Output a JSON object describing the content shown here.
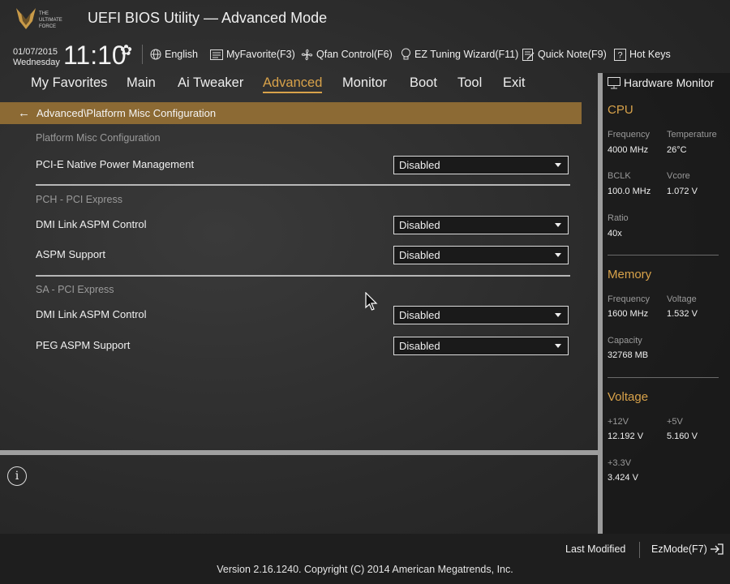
{
  "app": {
    "title": "UEFI BIOS Utility — Advanced Mode",
    "logo_text": "THE ULTIMATE FORCE"
  },
  "clock": {
    "date": "01/07/2015",
    "day": "Wednesday",
    "time": "11:10"
  },
  "toolbar": [
    {
      "label": "English",
      "icon": "globe-icon"
    },
    {
      "label": "MyFavorite(F3)",
      "icon": "favorite-list-icon"
    },
    {
      "label": "Qfan Control(F6)",
      "icon": "fan-icon"
    },
    {
      "label": "EZ Tuning Wizard(F11)",
      "icon": "lightbulb-icon"
    },
    {
      "label": "Quick Note(F9)",
      "icon": "note-icon"
    },
    {
      "label": "Hot Keys",
      "icon": "question-icon"
    }
  ],
  "nav": {
    "items": [
      "My Favorites",
      "Main",
      "Ai Tweaker",
      "Advanced",
      "Monitor",
      "Boot",
      "Tool",
      "Exit"
    ],
    "active": "Advanced"
  },
  "breadcrumb": "Advanced\\Platform Misc Configuration",
  "settings": {
    "platform_title": "Platform Misc Configuration",
    "pcie_native_label": "PCI-E Native Power Management",
    "pcie_native_value": "Disabled",
    "pch_title": "PCH - PCI Express",
    "pch_dmi_label": "DMI Link ASPM Control",
    "pch_dmi_value": "Disabled",
    "aspm_label": "ASPM Support",
    "aspm_value": "Disabled",
    "sa_title": "SA - PCI Express",
    "sa_dmi_label": "DMI Link ASPM Control",
    "sa_dmi_value": "Disabled",
    "peg_label": "PEG ASPM Support",
    "peg_value": "Disabled"
  },
  "hw_monitor": {
    "title": "Hardware Monitor",
    "cpu": {
      "title": "CPU",
      "frequency_label": "Frequency",
      "frequency": "4000 MHz",
      "temperature_label": "Temperature",
      "temperature": "26°C",
      "bclk_label": "BCLK",
      "bclk": "100.0 MHz",
      "vcore_label": "Vcore",
      "vcore": "1.072 V",
      "ratio_label": "Ratio",
      "ratio": "40x"
    },
    "memory": {
      "title": "Memory",
      "frequency_label": "Frequency",
      "frequency": "1600 MHz",
      "voltage_label": "Voltage",
      "voltage": "1.532 V",
      "capacity_label": "Capacity",
      "capacity": "32768 MB"
    },
    "voltage": {
      "title": "Voltage",
      "v12_label": "+12V",
      "v12": "12.192 V",
      "v5_label": "+5V",
      "v5": "5.160 V",
      "v33_label": "+3.3V",
      "v33": "3.424 V"
    }
  },
  "footer": {
    "last_modified": "Last Modified",
    "ezmode": "EzMode(F7)",
    "version": "Version 2.16.1240. Copyright (C) 2014 American Megatrends, Inc."
  },
  "colors": {
    "accent": "#d8a24a",
    "breadcrumb_bg": "#8c6a34"
  }
}
